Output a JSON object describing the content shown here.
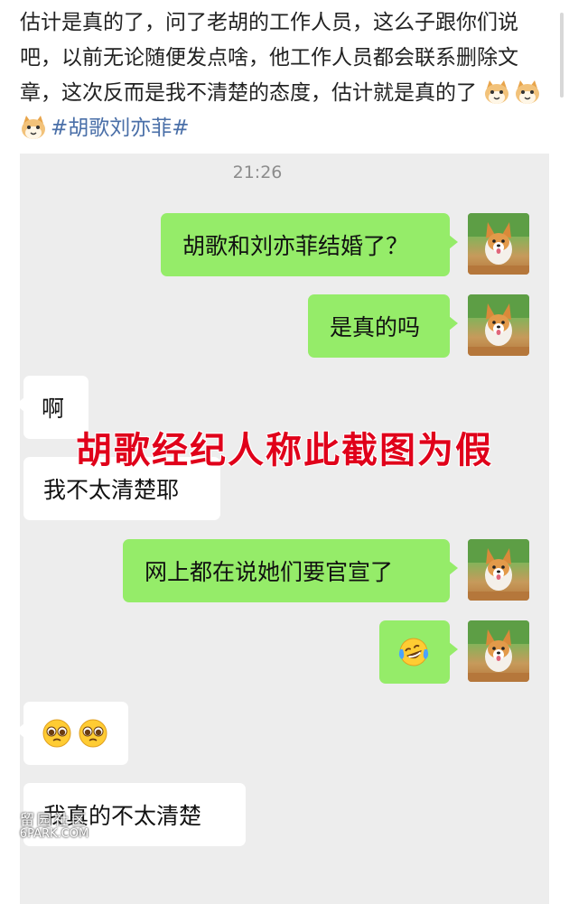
{
  "post": {
    "text": "估计是真的了，问了老胡的工作人员，这么子跟你们说吧，以前无论随便发点啥，他工作人员都会联系删除文章，这次反而是我不清楚的态度，估计就是真的了",
    "emojis": [
      "cat-emoji",
      "cat-emoji",
      "cat-emoji"
    ],
    "hashtag": "#胡歌刘亦菲#"
  },
  "chat": {
    "timestamp": "21:26",
    "messages": [
      {
        "side": "outgoing",
        "text": "胡歌和刘亦菲结婚了？"
      },
      {
        "side": "outgoing",
        "text": "是真的吗"
      },
      {
        "side": "incoming",
        "text": "啊"
      },
      {
        "side": "incoming",
        "text": "我不太清楚耶"
      },
      {
        "side": "outgoing",
        "text": "网上都在说她们要官宣了"
      },
      {
        "side": "outgoing",
        "emoji": "tears-of-joy-emoji"
      },
      {
        "side": "incoming",
        "emoji": "pleading-face-emoji x2"
      },
      {
        "side": "incoming",
        "text": "我真的不太清楚"
      }
    ]
  },
  "overlay": {
    "caption": "胡歌经纪人称此截图为假"
  },
  "watermark": {
    "line1": "留园社区",
    "line2": "6PARK.COM"
  },
  "colors": {
    "chat_bg": "#ededed",
    "outgoing_bubble": "#95ec69",
    "incoming_bubble": "#ffffff",
    "overlay_text": "#e0001a",
    "hashtag": "#4a6fa8"
  }
}
